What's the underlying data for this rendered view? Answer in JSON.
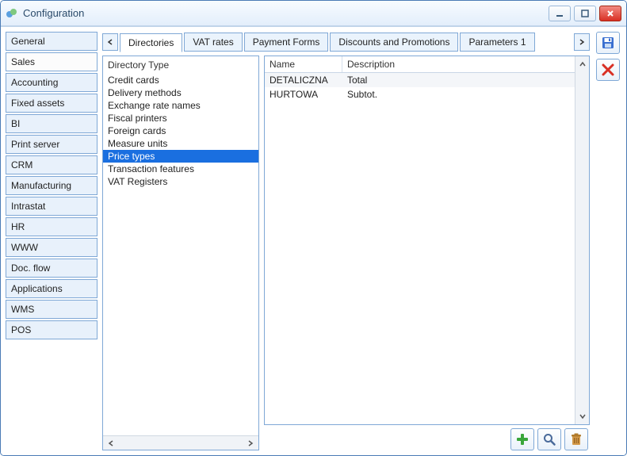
{
  "window": {
    "title": "Configuration"
  },
  "sidebar": {
    "items": [
      {
        "label": "General"
      },
      {
        "label": "Sales",
        "active": true
      },
      {
        "label": "Accounting"
      },
      {
        "label": "Fixed assets"
      },
      {
        "label": "BI"
      },
      {
        "label": "Print server"
      },
      {
        "label": "CRM"
      },
      {
        "label": "Manufacturing"
      },
      {
        "label": "Intrastat"
      },
      {
        "label": "HR"
      },
      {
        "label": "WWW"
      },
      {
        "label": "Doc. flow"
      },
      {
        "label": "Applications"
      },
      {
        "label": "WMS"
      },
      {
        "label": "POS"
      }
    ]
  },
  "tabs": [
    {
      "label": "Directories",
      "active": true
    },
    {
      "label": "VAT rates"
    },
    {
      "label": "Payment Forms"
    },
    {
      "label": "Discounts and Promotions"
    },
    {
      "label": "Parameters 1"
    }
  ],
  "directory_list": {
    "header": "Directory Type",
    "items": [
      "Credit cards",
      "Delivery methods",
      "Exchange rate names",
      "Fiscal printers",
      "Foreign cards",
      "Measure units",
      "Price types",
      "Transaction features",
      "VAT Registers"
    ],
    "selected_index": 6
  },
  "table": {
    "columns": [
      {
        "key": "name",
        "label": "Name"
      },
      {
        "key": "description",
        "label": "Description"
      }
    ],
    "rows": [
      {
        "name": "DETALICZNA",
        "description": "Total"
      },
      {
        "name": "HURTOWA",
        "description": "Subtot."
      }
    ]
  }
}
